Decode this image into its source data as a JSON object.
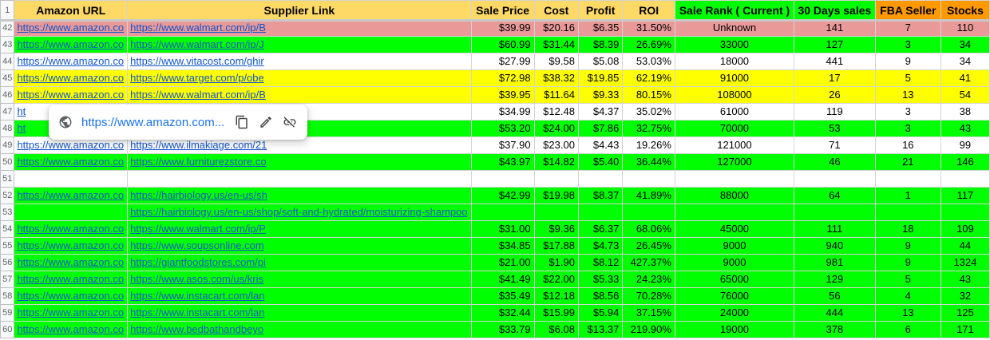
{
  "columns": {
    "amazon_url": "Amazon URL",
    "supplier_link": "Supplier Link",
    "sale_price": "Sale Price",
    "cost": "Cost",
    "profit": "Profit",
    "roi": "ROI",
    "sale_rank": "Sale Rank ( Current )",
    "days30": "30 Days sales",
    "fba": "FBA Seller",
    "stocks": "Stocks"
  },
  "header_row_number": "1",
  "colors": {
    "header_yellow": "#ffd966",
    "header_green": "#00ff00",
    "header_orange": "#ff9900",
    "row_red": "#ea9999",
    "row_green": "#00ff00",
    "row_yellow": "#ffff00",
    "row_white": "#ffffff"
  },
  "rows": [
    {
      "n": "42",
      "color": "red",
      "amazon": "https://www.amazon.co",
      "supplier": "https://www.walmart.com/ip/B",
      "price": "$39.99",
      "cost": "$20.16",
      "profit": "$6.35",
      "roi": "31.50%",
      "rank": "Unknown",
      "sales": "141",
      "fba": "7",
      "stock": "110"
    },
    {
      "n": "43",
      "color": "green",
      "amazon": "https://www.amazon.co",
      "supplier": "https://www.walmart.com/ip/J",
      "price": "$60.99",
      "cost": "$31.44",
      "profit": "$8.39",
      "roi": "26.69%",
      "rank": "33000",
      "sales": "127",
      "fba": "3",
      "stock": "34"
    },
    {
      "n": "44",
      "color": "white",
      "amazon": "https://www.amazon.co",
      "supplier": "https://www.vitacost.com/ghir",
      "price": "$27.99",
      "cost": "$9.58",
      "profit": "$5.08",
      "roi": "53.03%",
      "rank": "18000",
      "sales": "441",
      "fba": "9",
      "stock": "34"
    },
    {
      "n": "45",
      "color": "yellow",
      "amazon": "https://www.amazon.co",
      "supplier": "https://www.target.com/p/obe",
      "price": "$72.98",
      "cost": "$38.32",
      "profit": "$19.85",
      "roi": "62.19%",
      "rank": "91000",
      "sales": "17",
      "fba": "5",
      "stock": "41"
    },
    {
      "n": "46",
      "color": "yellow",
      "amazon": "https://www.amazon.co",
      "supplier": "https://www.walmart.com/ip/B",
      "price": "$39.95",
      "cost": "$11.64",
      "profit": "$9.33",
      "roi": "80.15%",
      "rank": "108000",
      "sales": "26",
      "fba": "13",
      "stock": "54"
    },
    {
      "n": "47",
      "color": "white",
      "amazon": "ht",
      "supplier": "",
      "price": "$34.99",
      "cost": "$12.48",
      "profit": "$4.37",
      "roi": "35.02%",
      "rank": "61000",
      "sales": "119",
      "fba": "3",
      "stock": "38"
    },
    {
      "n": "48",
      "color": "green",
      "amazon": "ht",
      "supplier": "",
      "price": "$53.20",
      "cost": "$24.00",
      "profit": "$7.86",
      "roi": "32.75%",
      "rank": "70000",
      "sales": "53",
      "fba": "3",
      "stock": "43"
    },
    {
      "n": "49",
      "color": "white",
      "amazon": "https://www.amazon.co",
      "supplier": "https://www.ilmakiage.com/21",
      "price": "$37.90",
      "cost": "$23.00",
      "profit": "$4.43",
      "roi": "19.26%",
      "rank": "121000",
      "sales": "71",
      "fba": "16",
      "stock": "99"
    },
    {
      "n": "50",
      "color": "green",
      "amazon": "https://www.amazon.co",
      "supplier": "https://www.furniturezstore.co",
      "price": "$43.97",
      "cost": "$14.82",
      "profit": "$5.40",
      "roi": "36.44%",
      "rank": "127000",
      "sales": "46",
      "fba": "21",
      "stock": "146"
    },
    {
      "n": "51",
      "color": "white",
      "amazon": "",
      "supplier": "",
      "price": "",
      "cost": "",
      "profit": "",
      "roi": "",
      "rank": "",
      "sales": "",
      "fba": "",
      "stock": ""
    },
    {
      "n": "52",
      "color": "green",
      "amazon": "https://www.amazon.co",
      "supplier": "https://hairbiology.us/en-us/sh",
      "price": "$42.99",
      "cost": "$19.98",
      "profit": "$8.37",
      "roi": "41.89%",
      "rank": "88000",
      "sales": "64",
      "fba": "1",
      "stock": "117"
    },
    {
      "n": "53",
      "color": "green",
      "amazon": "",
      "supplier": "https://hairbiology.us/en-us/shop/soft-and-hydrated/moisturizing-shampoo",
      "price": "",
      "cost": "",
      "profit": "",
      "roi": "",
      "rank": "",
      "sales": "",
      "fba": "",
      "stock": ""
    },
    {
      "n": "54",
      "color": "green",
      "amazon": "https://www.amazon.co",
      "supplier": "https://www.walmart.com/ip/P",
      "price": "$31.00",
      "cost": "$9.36",
      "profit": "$6.37",
      "roi": "68.06%",
      "rank": "45000",
      "sales": "111",
      "fba": "18",
      "stock": "109"
    },
    {
      "n": "55",
      "color": "green",
      "amazon": "https://www.amazon.co",
      "supplier": "https://www.soupsonline.com",
      "price": "$34.85",
      "cost": "$17.88",
      "profit": "$4.73",
      "roi": "26.45%",
      "rank": "9000",
      "sales": "940",
      "fba": "9",
      "stock": "44"
    },
    {
      "n": "56",
      "color": "green",
      "amazon": "https://www.amazon.co",
      "supplier": "https://giantfoodstores.com/pi",
      "price": "$21.00",
      "cost": "$1.90",
      "profit": "$8.12",
      "roi": "427.37%",
      "rank": "9000",
      "sales": "981",
      "fba": "9",
      "stock": "1324"
    },
    {
      "n": "57",
      "color": "green",
      "amazon": "https://www.amazon.co",
      "supplier": "https://www.asos.com/us/kris",
      "price": "$41.49",
      "cost": "$22.00",
      "profit": "$5.33",
      "roi": "24.23%",
      "rank": "65000",
      "sales": "129",
      "fba": "5",
      "stock": "43"
    },
    {
      "n": "58",
      "color": "green",
      "amazon": "https://www.amazon.co",
      "supplier": "https://www.instacart.com/lan",
      "price": "$35.49",
      "cost": "$12.18",
      "profit": "$8.56",
      "roi": "70.28%",
      "rank": "76000",
      "sales": "56",
      "fba": "4",
      "stock": "32"
    },
    {
      "n": "59",
      "color": "green",
      "amazon": "https://www.amazon.co",
      "supplier": "https://www.instacart.com/lan",
      "price": "$32.44",
      "cost": "$15.99",
      "profit": "$5.94",
      "roi": "37.15%",
      "rank": "24000",
      "sales": "444",
      "fba": "13",
      "stock": "125"
    },
    {
      "n": "60",
      "color": "green",
      "amazon": "https://www.amazon.co",
      "supplier": "https://www.bedbathandbeyo",
      "price": "$33.79",
      "cost": "$6.08",
      "profit": "$13.37",
      "roi": "219.90%",
      "rank": "19000",
      "sales": "378",
      "fba": "6",
      "stock": "171"
    }
  ],
  "link_popup": {
    "url": "https://www.amazon.com...",
    "icons": [
      "globe-icon",
      "copy-icon",
      "edit-icon",
      "unlink-icon"
    ]
  }
}
